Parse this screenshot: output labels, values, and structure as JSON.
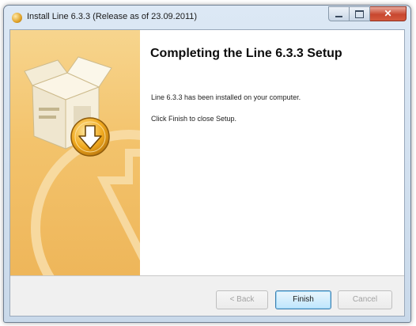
{
  "window": {
    "title": "Install Line 6.3.3 (Release as of 23.09.2011)"
  },
  "content": {
    "heading": "Completing the Line 6.3.3 Setup",
    "installed_text": "Line 6.3.3 has been installed on your computer.",
    "instruction_text": "Click Finish to close Setup."
  },
  "buttons": {
    "back": "< Back",
    "finish": "Finish",
    "cancel": "Cancel"
  },
  "colors": {
    "sidebar": "#f3c36c",
    "default_button_border": "#3c7fb1"
  },
  "icons": {
    "app": "installer-disc-icon",
    "graphic": "box-download-graphic"
  }
}
